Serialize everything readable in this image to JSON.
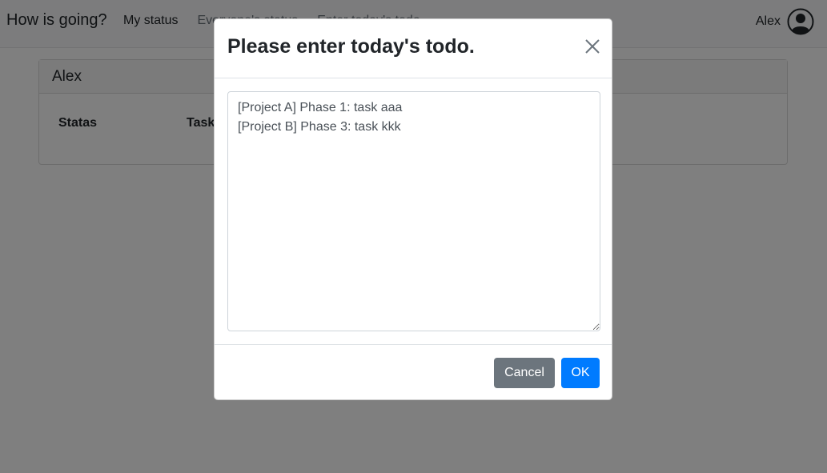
{
  "navbar": {
    "brand": "How is going?",
    "links": [
      "My status",
      "Everyone's status",
      "Enter today's todo"
    ],
    "user_name": "Alex",
    "avatar_icon": "user-circle-icon"
  },
  "card": {
    "title": "Alex",
    "columns": [
      "Statas",
      "Task"
    ]
  },
  "modal": {
    "title": "Please enter today's todo.",
    "close_icon": "close-icon",
    "todo_value": "[Project A] Phase 1: task aaa\n[Project B] Phase 3: task kkk",
    "cancel_label": "Cancel",
    "ok_label": "OK"
  },
  "colors": {
    "primary": "#007bff",
    "secondary": "#6c757d",
    "backdrop": "rgba(0,0,0,0.5)"
  }
}
